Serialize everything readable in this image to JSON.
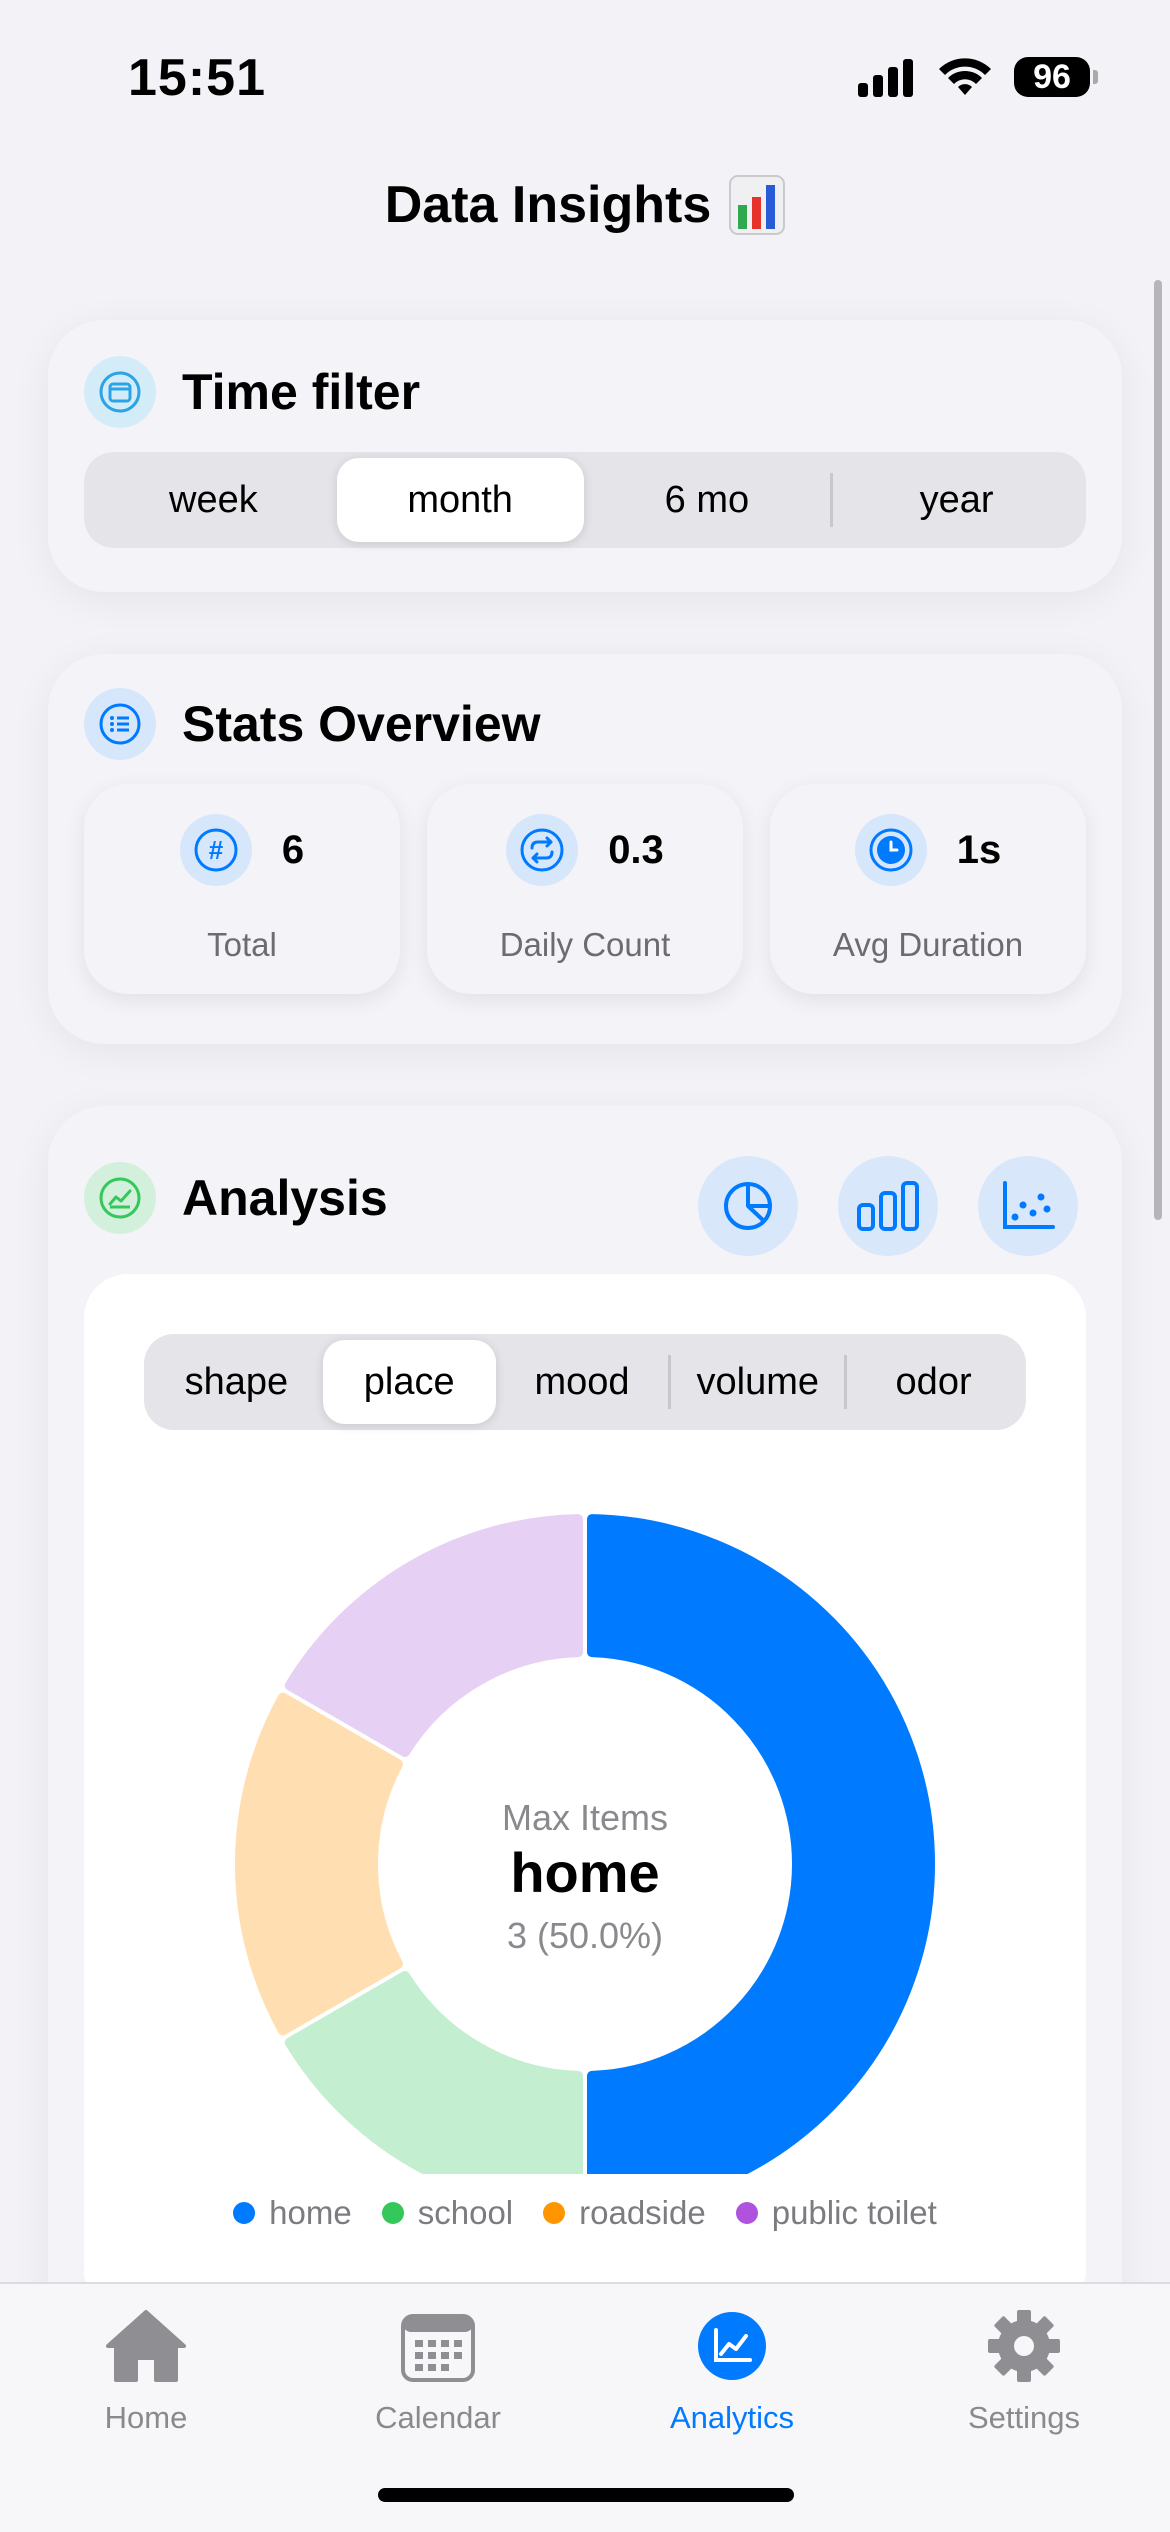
{
  "status_bar": {
    "time": "15:51",
    "battery": "96"
  },
  "page": {
    "title": "Data Insights"
  },
  "time_filter": {
    "title": "Time filter",
    "options": [
      "week",
      "month",
      "6 mo",
      "year"
    ],
    "selected": "month"
  },
  "stats": {
    "title": "Stats Overview",
    "items": [
      {
        "value": "6",
        "label": "Total",
        "icon": "hash-icon"
      },
      {
        "value": "0.3",
        "label": "Daily Count",
        "icon": "repeat-icon"
      },
      {
        "value": "1s",
        "label": "Avg Duration",
        "icon": "clock-icon"
      }
    ]
  },
  "analysis": {
    "title": "Analysis",
    "chart_buttons": [
      "pie-chart-icon",
      "bar-chart-icon",
      "scatter-chart-icon"
    ],
    "dimensions": [
      "shape",
      "place",
      "mood",
      "volume",
      "odor"
    ],
    "selected_dimension": "place",
    "center": {
      "caption": "Max Items",
      "name": "home",
      "detail": "3 (50.0%)"
    }
  },
  "chart_data": {
    "type": "pie",
    "categories": [
      "home",
      "school",
      "roadside",
      "public toilet"
    ],
    "values": [
      3,
      1,
      1,
      1
    ],
    "colors": [
      "#007aff",
      "#c4eed0",
      "#ffdfb2",
      "#e6d0f4"
    ],
    "legend_colors": [
      "#007aff",
      "#34c759",
      "#ff9500",
      "#af52de"
    ]
  },
  "tab_bar": {
    "items": [
      {
        "label": "Home",
        "icon": "house-icon"
      },
      {
        "label": "Calendar",
        "icon": "calendar-icon"
      },
      {
        "label": "Analytics",
        "icon": "analytics-icon"
      },
      {
        "label": "Settings",
        "icon": "gear-icon"
      }
    ],
    "active": "Analytics"
  },
  "colors": {
    "accent": "#007aff",
    "background": "#f2f2f7"
  }
}
